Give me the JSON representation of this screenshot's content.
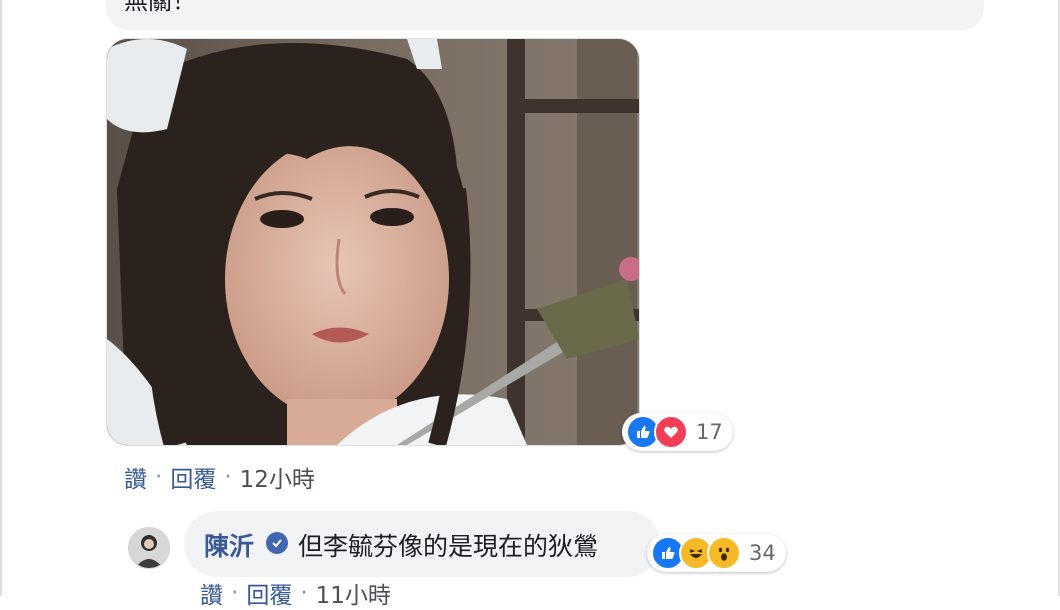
{
  "previous_comment": {
    "text_fragment": "無關！"
  },
  "photo_comment": {
    "reactions": {
      "icons": [
        "like-icon",
        "love-icon"
      ],
      "count": "17"
    },
    "actions": {
      "like": "讚",
      "reply": "回覆",
      "time": "12小時"
    }
  },
  "reply_comment": {
    "author": "陳沂",
    "verified": true,
    "text": "但李毓芬像的是現在的狄鶯",
    "reactions": {
      "icons": [
        "like-icon",
        "haha-icon",
        "wow-icon"
      ],
      "count": "34"
    },
    "actions": {
      "like": "讚",
      "reply": "回覆",
      "time": "11小時"
    }
  },
  "colors": {
    "link": "#385898",
    "bubble": "#f2f3f5",
    "like": "#1877f2",
    "love": "#f33e58"
  }
}
